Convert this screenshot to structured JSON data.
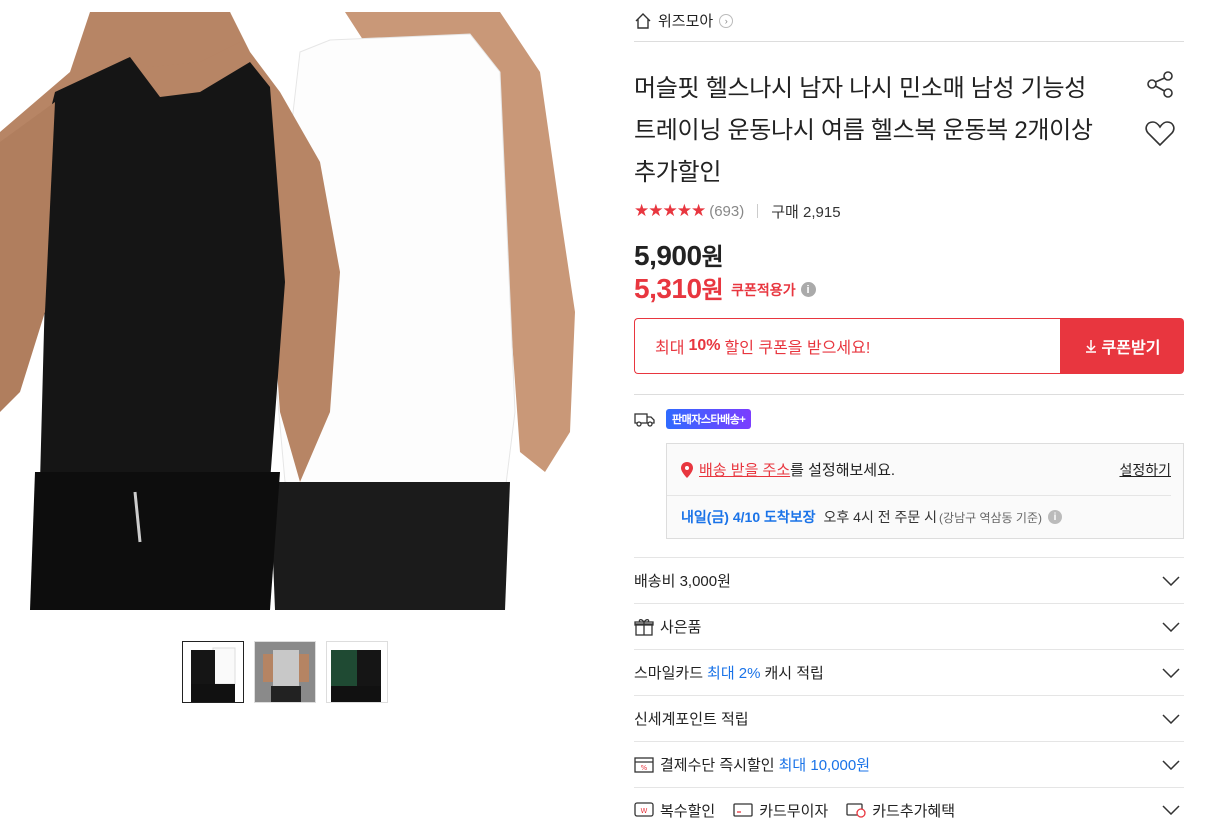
{
  "store": {
    "name": "위즈모아"
  },
  "product": {
    "title": "머슬핏 헬스나시 남자 나시 민소매 남성 기능성 트레이닝 운동나시 여름 헬스복 운동복 2개이상 추가할인",
    "rating_stars": "★★★★★",
    "review_count": "(693)",
    "purchase_count": "구매 2,915",
    "price": "5,900",
    "sale_price": "5,310",
    "currency": "원",
    "coupon_applied_label": "쿠폰적용가"
  },
  "coupon": {
    "msg_prefix": "최대",
    "msg_percent": "10%",
    "msg_suffix": "할인 쿠폰을 받으세요!",
    "button_label": "쿠폰받기"
  },
  "delivery": {
    "badge": "판매자스타배송+",
    "address_link": "배송 받을 주소",
    "address_suffix": "를 설정해보세요.",
    "set_label": "설정하기",
    "eta": "내일(금) 4/10 도착보장",
    "eta_condition": "오후 4시 전 주문 시",
    "eta_area": "(강남구 역삼동 기준)"
  },
  "options": {
    "shipping_fee": "배송비 3,000원",
    "gift": "사은품",
    "smile_card_prefix": "스마일카드",
    "smile_card_highlight": "최대 2%",
    "smile_card_suffix": "캐시 적립",
    "shinsegae_point": "신세계포인트 적립",
    "payment_prefix": "결제수단 즉시할인",
    "payment_highlight": "최대 10,000원",
    "multi_discount": "복수할인",
    "card_installment": "카드무이자",
    "card_benefit": "카드추가혜택"
  },
  "colors": {
    "accent": "#e8363f",
    "link_blue": "#1a73e8"
  },
  "icons": [
    "home-icon",
    "share-icon",
    "heart-icon",
    "truck-icon",
    "pin-icon",
    "gift-icon",
    "chevron-down-icon"
  ]
}
